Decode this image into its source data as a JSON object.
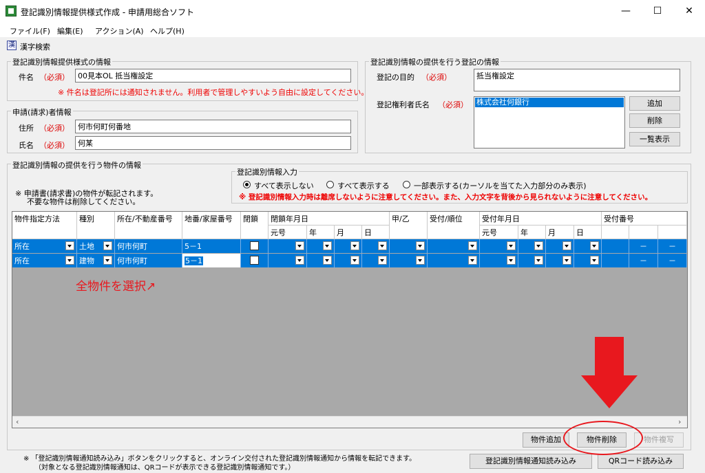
{
  "window": {
    "title": "登記識別情報提供様式作成 - 申請用総合ソフト",
    "minimize": "—",
    "maximize": "☐",
    "close": "✕"
  },
  "menu": [
    "ファイル(F)",
    "編集(E)",
    "アクション(A)",
    "ヘルプ(H)"
  ],
  "toolbar": {
    "icon_glyph": "漢",
    "label": "漢字検索"
  },
  "form_info": {
    "title": "登記識別情報提供様式の情報",
    "subject_label": "件名",
    "required": "（必須）",
    "subject_value": "00見本OL 抵当権設定",
    "note": "※ 件名は登記所には通知されません。利用者で管理しやすいよう自由に設定してください。"
  },
  "applicant": {
    "title": "申請(請求)者情報",
    "address_label": "住所",
    "address_value": "何市何町何番地",
    "name_label": "氏名",
    "name_value": "何某"
  },
  "registration": {
    "title": "登記識別情報の提供を行う登記の情報",
    "purpose_label": "登記の目的",
    "purpose_value": "抵当権設定",
    "holder_label": "登記権利者氏名",
    "holder_selected": "株式会社何銀行",
    "add_button": "追加",
    "delete_button": "削除",
    "list_button": "一覧表示"
  },
  "property": {
    "title": "登記識別情報の提供を行う物件の情報",
    "note_line1": "※ 申請書(請求書)の物件が転記されます。",
    "note_line2": "不要な物件は削除してください。",
    "input_group_title": "登記識別情報入力",
    "radio_all_hide": "すべて表示しない",
    "radio_all_show": "すべて表示する",
    "radio_partial": "一部表示する(カーソルを当てた入力部分のみ表示)",
    "warning": "※ 登記識別情報入力時は離席しないように注意してください。また、入力文字を背後から見られないように注意してください。"
  },
  "grid": {
    "headers": {
      "method": "物件指定方法",
      "type": "種別",
      "location": "所在/不動産番号",
      "lot": "地番/家屋番号",
      "closed": "閉鎖",
      "closed_date": "閉鎖年月日",
      "era": "元号",
      "year": "年",
      "month": "月",
      "day": "日",
      "kou_otsu": "甲/乙",
      "order": "受付/順位",
      "receipt_date": "受付年月日",
      "r_era": "元号",
      "r_year": "年",
      "r_month": "月",
      "r_day": "日",
      "receipt_no": "受付番号"
    },
    "rows": [
      {
        "method": "所在",
        "type": "土地",
        "location": "何市何町",
        "lot": "5－1",
        "dash1": "－",
        "dash2": "－"
      },
      {
        "method": "所在",
        "type": "建物",
        "location": "何市何町",
        "lot": "5－1",
        "dash1": "－",
        "dash2": "－"
      }
    ],
    "annotation": "全物件を選択↗"
  },
  "buttons": {
    "add_property": "物件追加",
    "delete_property": "物件削除",
    "copy_property": "物件複写",
    "read_notice": "登記識別情報通知読み込み",
    "read_qr": "QRコード読み込み"
  },
  "footer": {
    "note_line1": "※ 「登記識別情報通知読み込み」ボタンをクリックすると、オンライン交付された登記識別情報通知から情報を転記できます。",
    "note_line2": "（対象となる登記識別情報通知は、QRコードが表示できる登記識別情報通知です。）"
  },
  "colors": {
    "selection": "#0078d7",
    "required": "#dd0000",
    "annotation": "#e8181e"
  }
}
